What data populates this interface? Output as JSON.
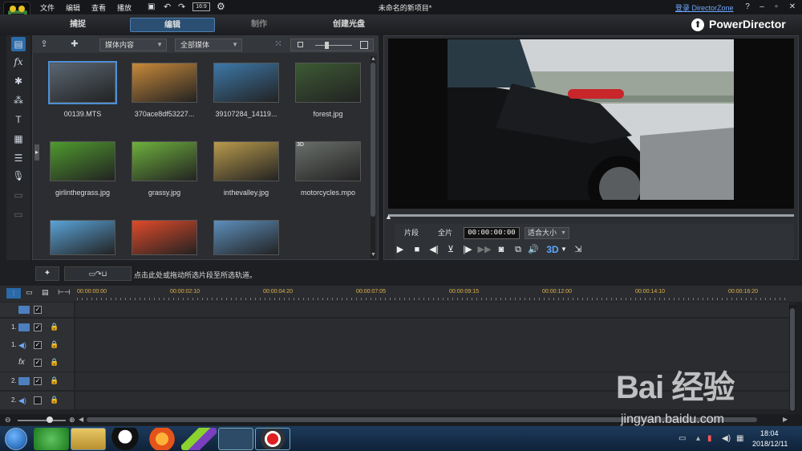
{
  "menu": {
    "file": "文件",
    "edit": "编辑",
    "view": "查看",
    "play": "播放"
  },
  "project_title": "未命名的新项目*",
  "login_link": "登录 DirectorZone",
  "window_buttons": {
    "help": "?",
    "minimize": "–",
    "maximize": "▫",
    "close": "✕"
  },
  "mode_tabs": {
    "capture": "捕捉",
    "edit": "编辑",
    "produce": "制作",
    "create_disc": "创建光盘"
  },
  "brand": "PowerDirector",
  "library": {
    "dropdown_content": "媒体内容",
    "dropdown_filter": "全部媒体",
    "items": [
      {
        "label": "00139.MTS",
        "color": "#5a6672"
      },
      {
        "label": "370ace8df53227...",
        "color": "#c8893a"
      },
      {
        "label": "39107284_14119...",
        "color": "#3d78a8"
      },
      {
        "label": "forest.jpg",
        "color": "#3d5a34"
      },
      {
        "label": "girlinthegrass.jpg",
        "color": "#4f9a2e"
      },
      {
        "label": "grassy.jpg",
        "color": "#6eb03c"
      },
      {
        "label": "inthevalley.jpg",
        "color": "#b89a4c"
      },
      {
        "label": "motorcycles.mpo",
        "color": "#6a6f6a"
      },
      {
        "label": "",
        "color": "#5aa3d8"
      },
      {
        "label": "",
        "color": "#e04a2a"
      },
      {
        "label": "",
        "color": "#5d8fbc"
      }
    ],
    "badge_3d": "3D"
  },
  "preview": {
    "segment_label": "片段",
    "full_label": "全片",
    "timecode": "00:00:00:00",
    "fit_label": "适合大小",
    "btn_3d": "3D"
  },
  "hint_text": "点击此处或拖动所选片段至所选轨道。",
  "timeline": {
    "ticks": [
      "00:00:00:00",
      "00:00:02:10",
      "00:00:04:20",
      "00:00:07:05",
      "00:00:09:15",
      "00:00:12:00",
      "00:00:14:10",
      "00:00:16:20"
    ],
    "tracks": [
      {
        "num": "",
        "type": "video",
        "checked": true,
        "locked": false
      },
      {
        "num": "1.",
        "type": "video",
        "checked": true,
        "locked": true
      },
      {
        "num": "1.",
        "type": "audio",
        "checked": true,
        "locked": true
      },
      {
        "num": "",
        "type": "fx",
        "checked": true,
        "locked": true
      },
      {
        "num": "2.",
        "type": "video",
        "checked": true,
        "locked": true
      },
      {
        "num": "2.",
        "type": "audio",
        "checked": false,
        "locked": true
      }
    ]
  },
  "taskbar": {
    "time": "18:04",
    "date": "2018/12/11"
  },
  "watermark": {
    "text": "Bai 经验",
    "url": "jingyan.baidu.com"
  },
  "colors": {
    "accent": "#2a4f73",
    "timeline_tick": "#e0b24a",
    "brand_text": "#ffffff"
  }
}
